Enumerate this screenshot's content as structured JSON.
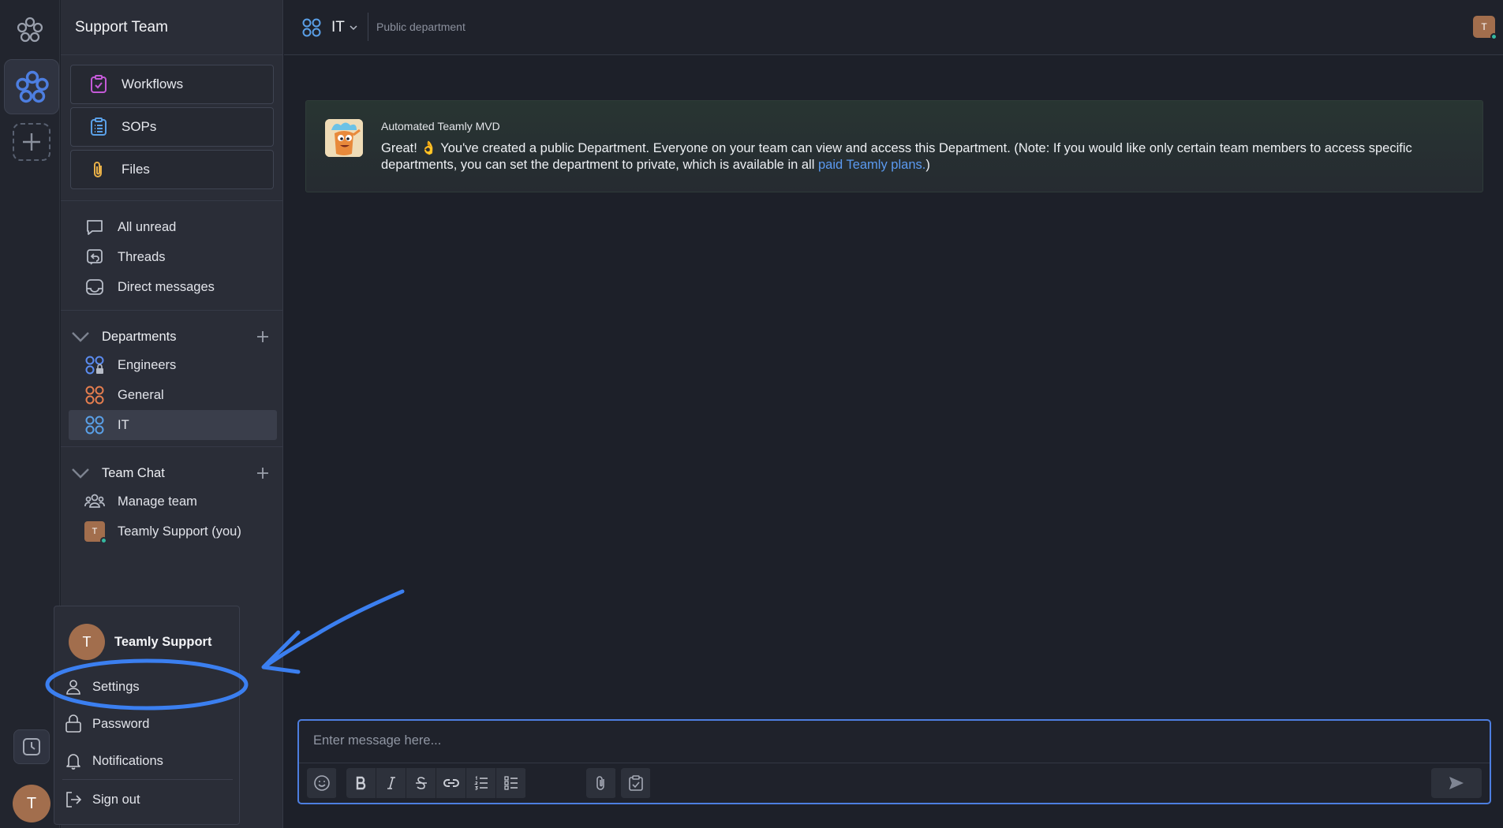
{
  "workspace": {
    "name": "Support Team"
  },
  "tools": [
    {
      "label": "Workflows",
      "icon": "workflow-clipboard-icon"
    },
    {
      "label": "SOPs",
      "icon": "sop-list-icon"
    },
    {
      "label": "Files",
      "icon": "paperclip-icon"
    }
  ],
  "nav": [
    {
      "label": "All unread",
      "icon": "chat-bubble-icon"
    },
    {
      "label": "Threads",
      "icon": "threads-icon"
    },
    {
      "label": "Direct messages",
      "icon": "inbox-icon"
    }
  ],
  "departments": {
    "title": "Departments",
    "items": [
      {
        "label": "Engineers",
        "color": "#5b8cf0",
        "private": true
      },
      {
        "label": "General",
        "color": "#e57e4f",
        "private": false
      },
      {
        "label": "IT",
        "color": "#5aa0e8",
        "private": false
      }
    ]
  },
  "team_chat": {
    "title": "Team Chat",
    "manage": "Manage team",
    "self": "Teamly Support (you)",
    "self_initial": "T"
  },
  "topbar": {
    "department": "IT",
    "subtitle": "Public department",
    "user_initial": "T"
  },
  "message": {
    "sender": "Automated Teamly MVD",
    "text_before": "Great! 👌 You've created a public Department. Everyone on your team can view and access this Department. (Note: If you would like only certain team members to access specific departments, you can set the department to private, which is available in all ",
    "link": "paid Teamly plans.",
    "text_after": ")"
  },
  "composer": {
    "placeholder": "Enter message here..."
  },
  "user_menu": {
    "name": "Teamly Support",
    "initial": "T",
    "items": [
      "Settings",
      "Password",
      "Notifications",
      "Sign out"
    ]
  },
  "rail": {
    "user_initial": "T"
  },
  "colors": {
    "accent": "#4d7ee0",
    "highlight": "#3b7ff0"
  }
}
